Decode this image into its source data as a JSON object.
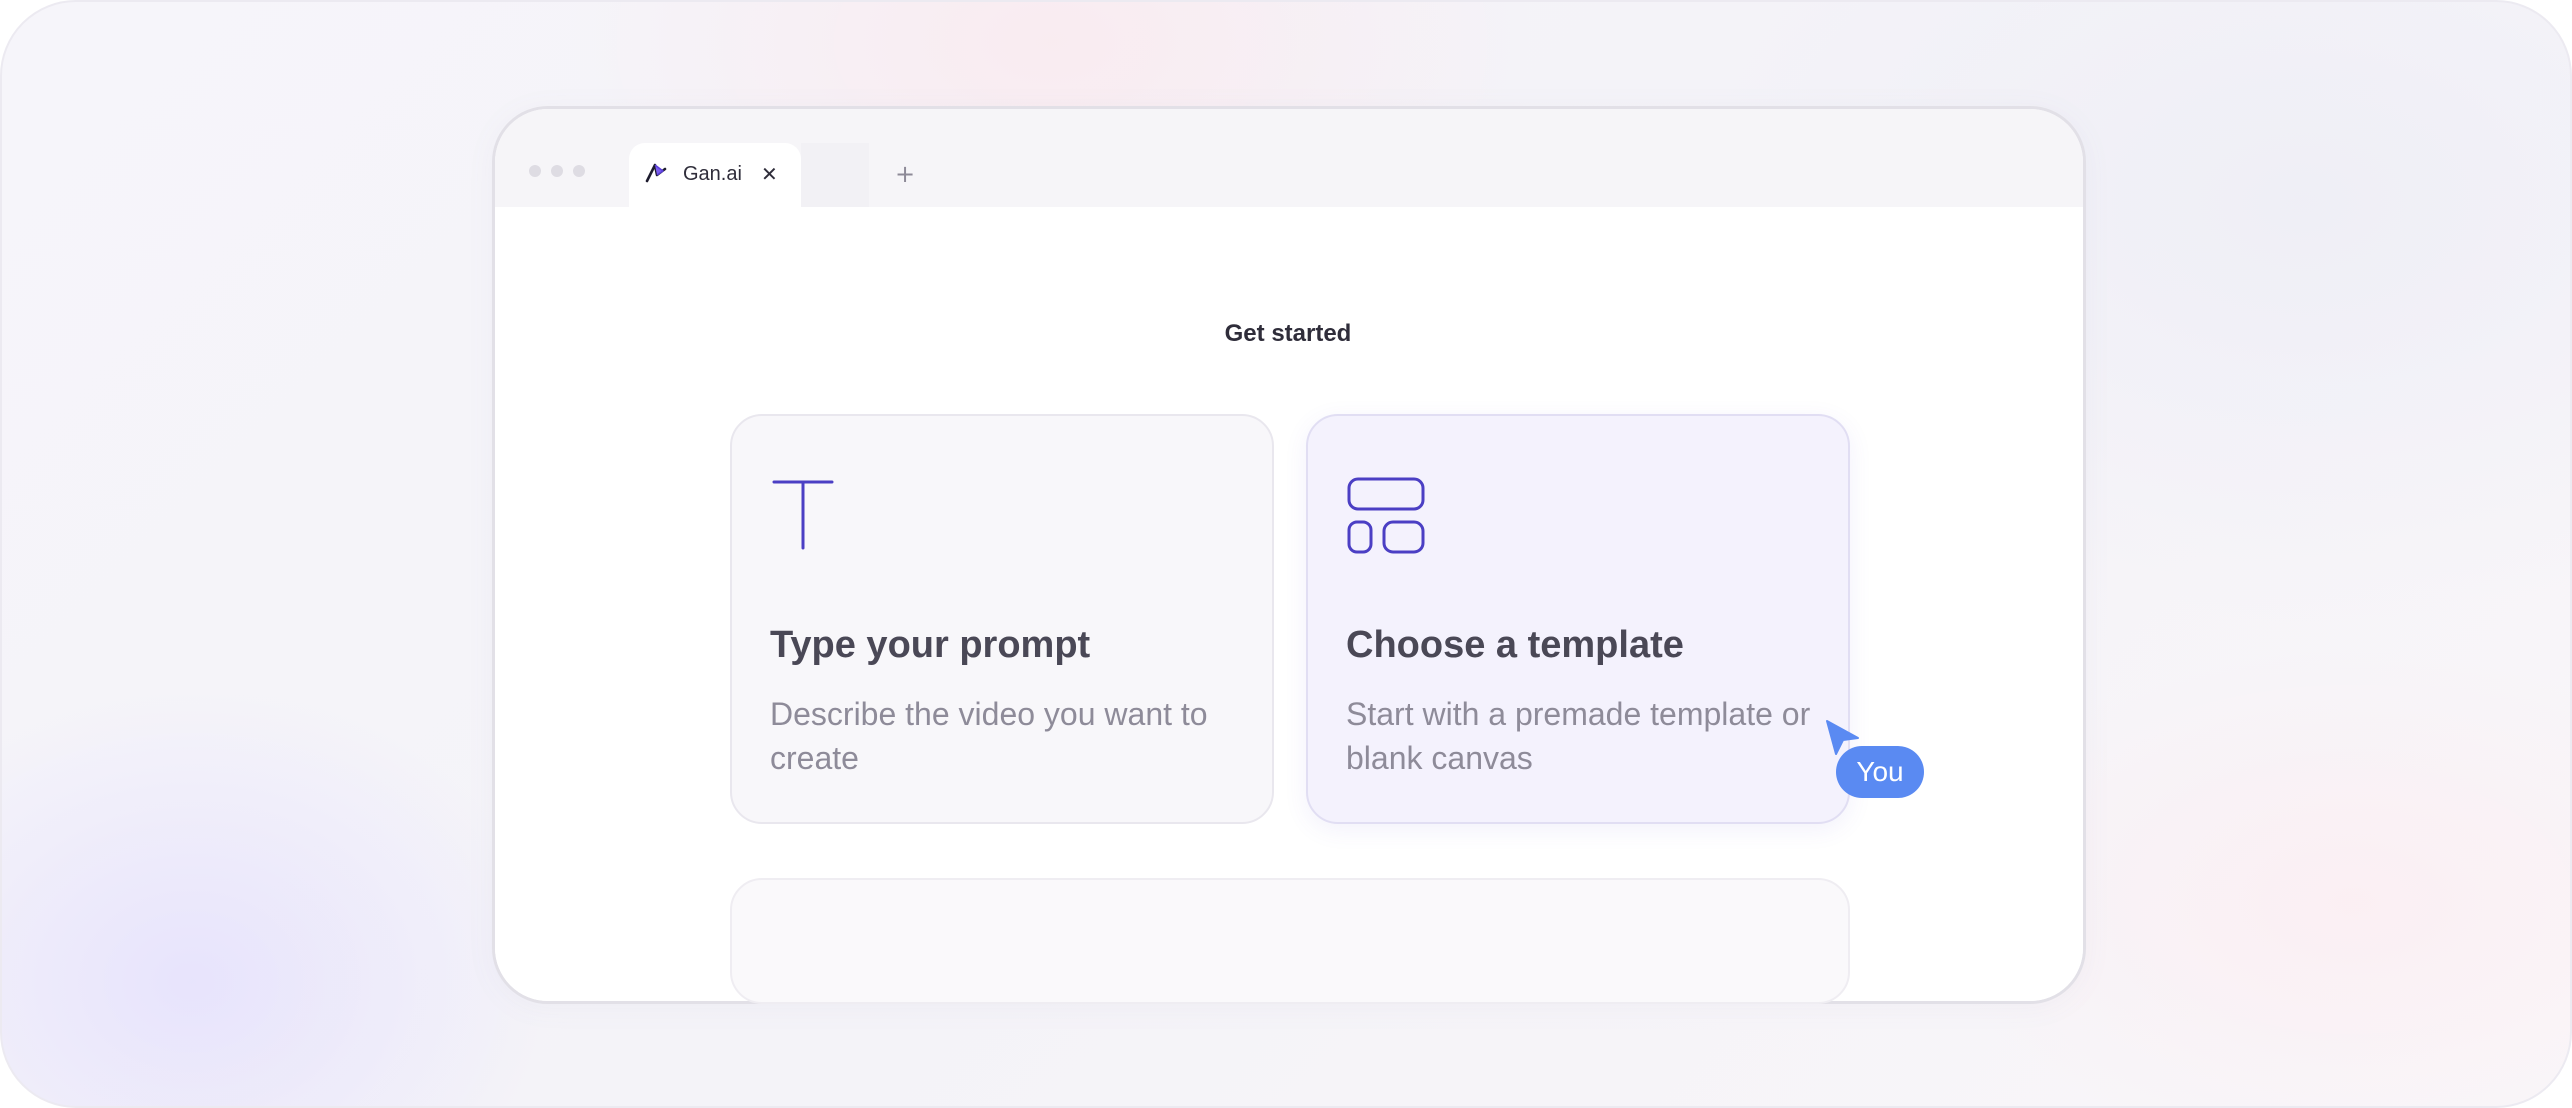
{
  "browser": {
    "tab": {
      "title": "Gan.ai",
      "close_glyph": "✕",
      "icon": "gan-logo-icon"
    },
    "new_tab_glyph": "+"
  },
  "page": {
    "title": "Get started"
  },
  "cards": [
    {
      "icon": "text-t-icon",
      "title": "Type your prompt",
      "description": "Describe the video you want to create"
    },
    {
      "icon": "template-layout-icon",
      "title": "Choose a template",
      "description": "Start with a premade template or blank canvas"
    }
  ],
  "cursor": {
    "label": "You",
    "color": "#5a8af2"
  },
  "colors": {
    "accent": "#4b3fc4",
    "text_dark": "#4a4856",
    "text_muted": "#8e8b99"
  }
}
